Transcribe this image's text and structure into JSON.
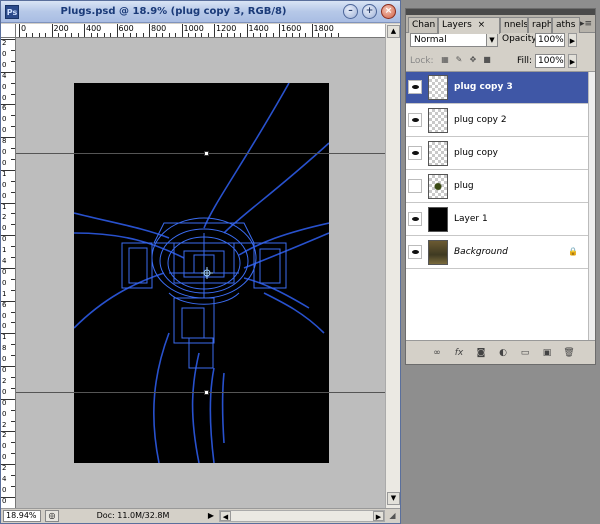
{
  "document": {
    "title": "Plugs.psd @ 18.9% (plug copy 3, RGB/8)",
    "app_icon": "Ps",
    "window_buttons": {
      "minimize": "–",
      "maximize": "+",
      "close": "×"
    },
    "ruler_top": [
      "0",
      "200",
      "400",
      "600",
      "800",
      "1000",
      "1200",
      "1400",
      "1600",
      "1800"
    ],
    "ruler_left": [
      "2",
      "0",
      "0",
      "4",
      "0",
      "0",
      "6",
      "0",
      "0",
      "8",
      "0",
      "0",
      "1",
      "0",
      "0",
      "1",
      "2",
      "0",
      "0",
      "1",
      "4",
      "0",
      "0",
      "1",
      "6",
      "0",
      "0",
      "1",
      "8",
      "0",
      "0",
      "2",
      "0",
      "0",
      "0",
      "2",
      "2",
      "0",
      "0",
      "2",
      "4",
      "0",
      "0"
    ],
    "status": {
      "zoom": "18.94%",
      "doc_size": "Doc: 11.0M/32.8M",
      "menu_arrow": "▶",
      "scroll_left": "◀",
      "scroll_right": "▶"
    }
  },
  "panel": {
    "tabs": [
      "Chan",
      "Layers",
      "nnels",
      "raph",
      "aths"
    ],
    "active_tab_close": "×",
    "blend_mode": "Normal",
    "opacity_label": "Opacity:",
    "opacity_value": "100%",
    "lock_label": "Lock:",
    "fill_label": "Fill:",
    "fill_value": "100%",
    "layers": [
      {
        "name": "plug copy 3",
        "visible": true,
        "selected": true
      },
      {
        "name": "plug copy 2",
        "visible": true,
        "selected": false
      },
      {
        "name": "plug copy",
        "visible": true,
        "selected": false
      },
      {
        "name": "plug",
        "visible": false,
        "selected": false
      },
      {
        "name": "Layer 1",
        "visible": true,
        "selected": false
      },
      {
        "name": "Background",
        "visible": true,
        "selected": false,
        "locked": true
      }
    ]
  },
  "colors": {
    "selection": "#3f57a6",
    "art_lines": "#2b56d8",
    "canvas_bg": "#bdbdbd"
  }
}
